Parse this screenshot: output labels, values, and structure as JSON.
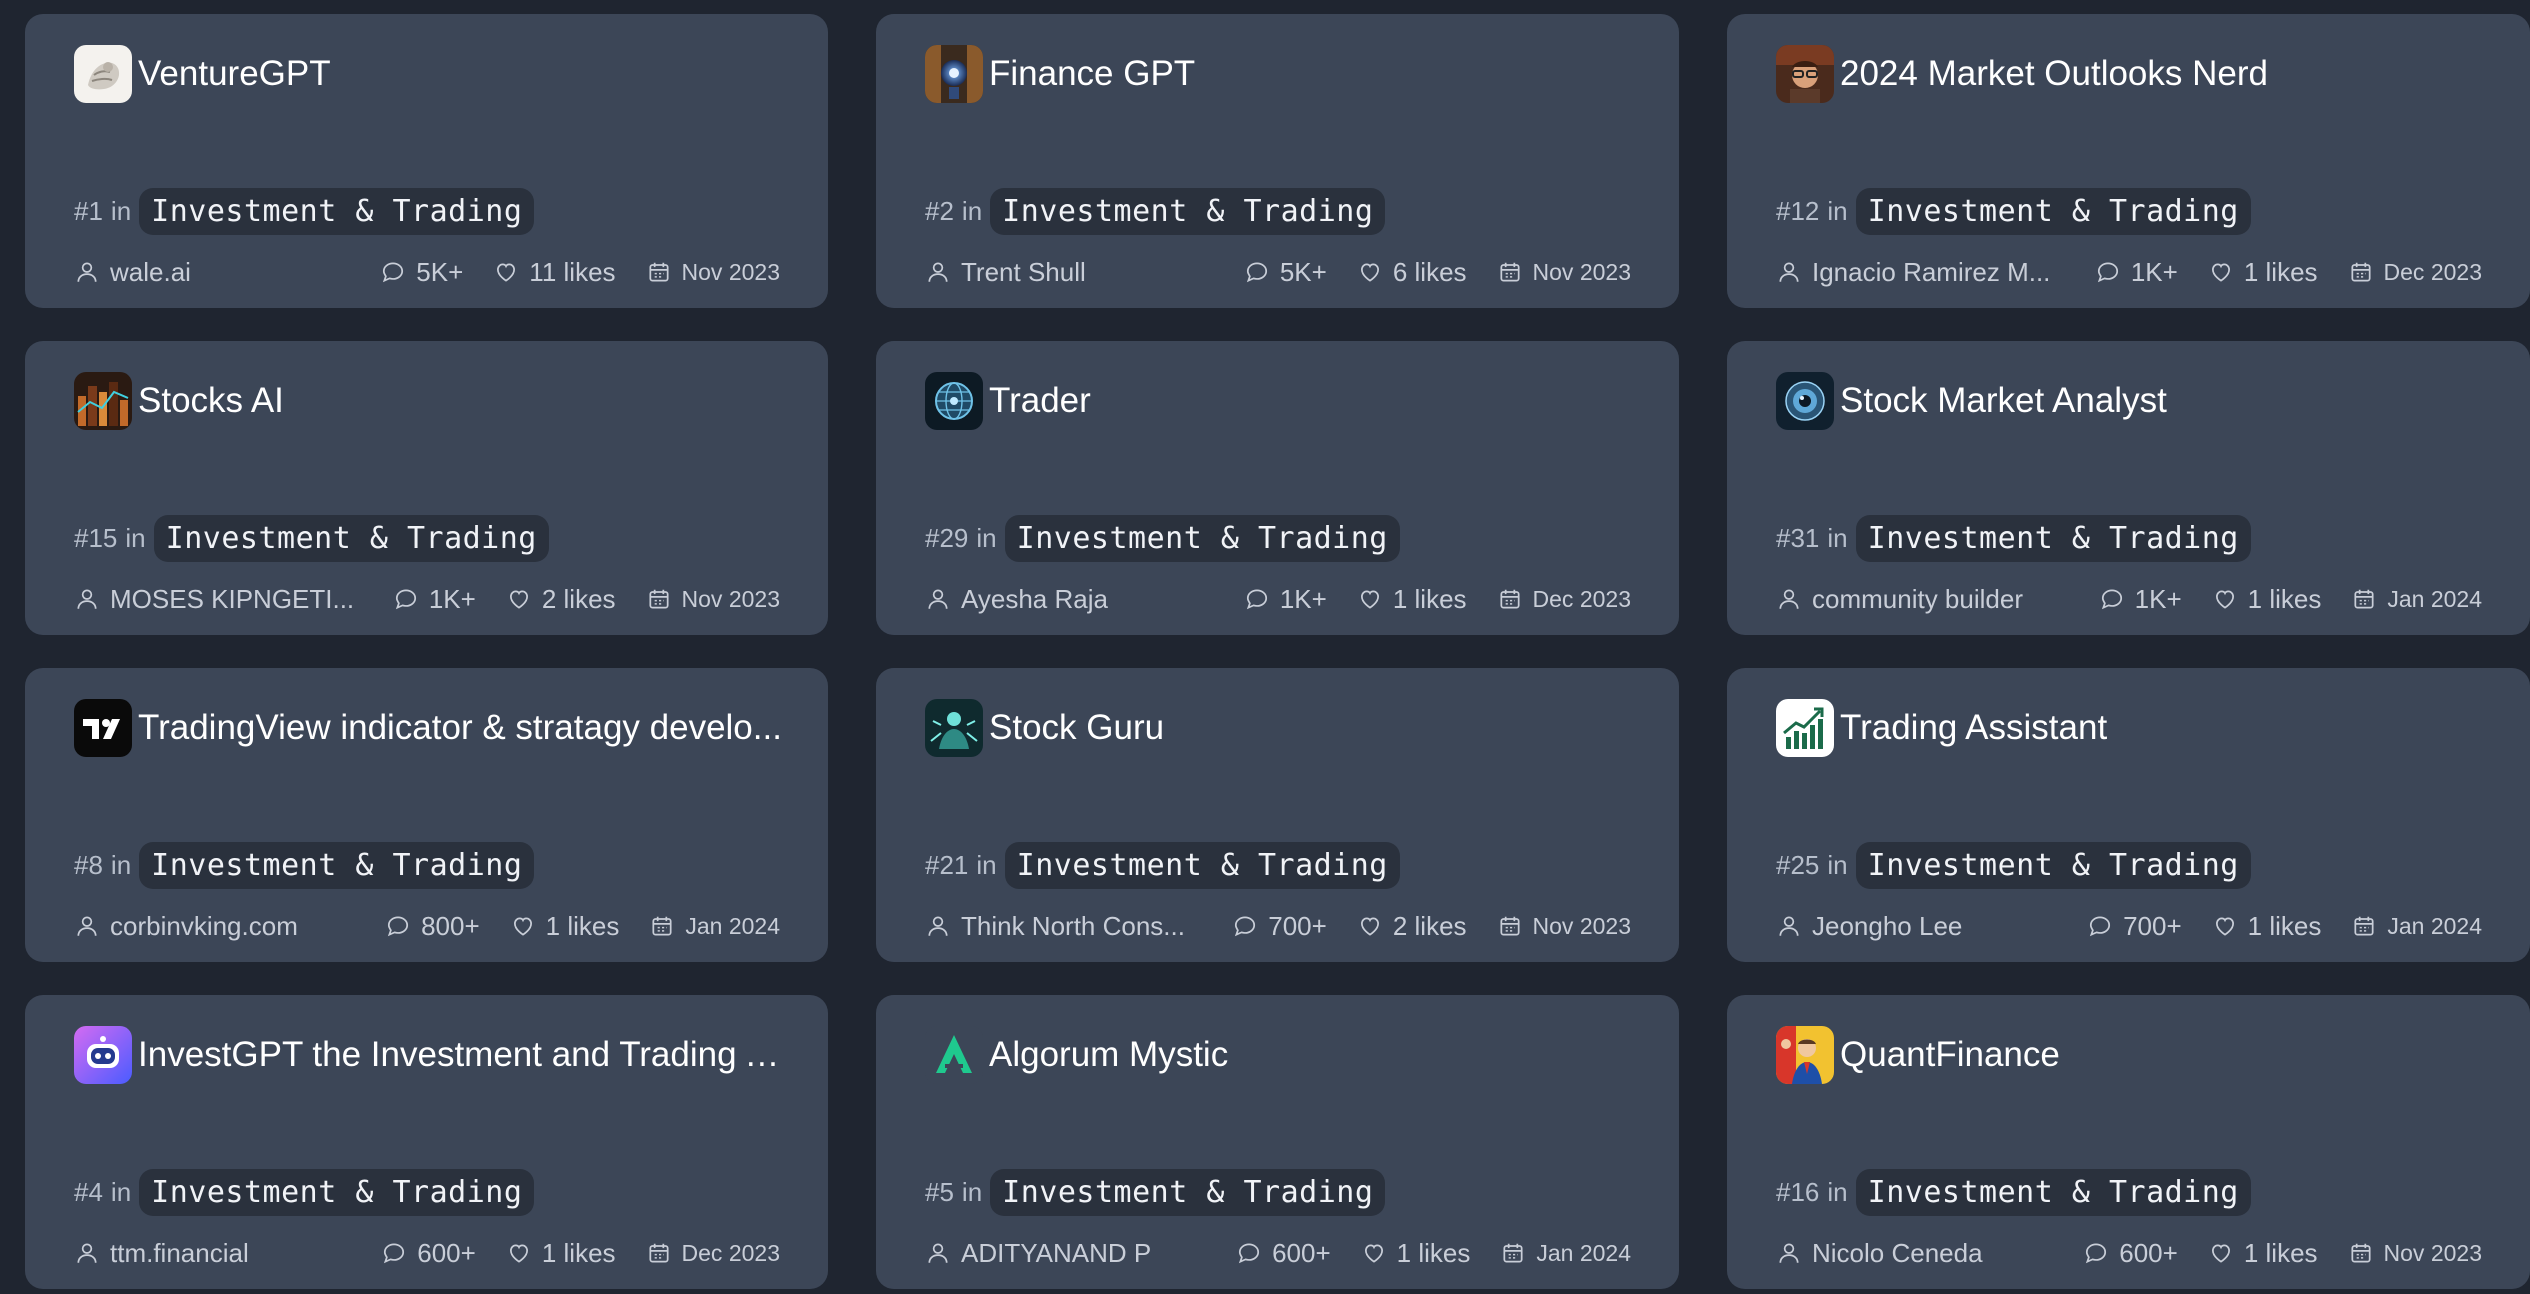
{
  "cards": [
    {
      "title": "VentureGPT",
      "rank": "#1",
      "in_label": "in",
      "category": "Investment & Trading",
      "author": "wale.ai",
      "conversations": "5K+",
      "likes": "11 likes",
      "date": "Nov 2023",
      "avatar_icon": "fist-sculpture-icon"
    },
    {
      "title": "Finance GPT",
      "rank": "#2",
      "in_label": "in",
      "category": "Investment & Trading",
      "author": "Trent Shull",
      "conversations": "5K+",
      "likes": "6 likes",
      "date": "Nov 2023",
      "avatar_icon": "robot-figure-icon"
    },
    {
      "title": "2024 Market Outlooks Nerd",
      "rank": "#12",
      "in_label": "in",
      "category": "Investment & Trading",
      "author": "Ignacio Ramirez M...",
      "conversations": "1K+",
      "likes": "1 likes",
      "date": "Dec 2023",
      "avatar_icon": "nerd-portrait-icon"
    },
    {
      "title": "Stocks AI",
      "rank": "#15",
      "in_label": "in",
      "category": "Investment & Trading",
      "author": "MOSES KIPNGETI...",
      "conversations": "1K+",
      "likes": "2 likes",
      "date": "Nov 2023",
      "avatar_icon": "city-chart-icon"
    },
    {
      "title": "Trader",
      "rank": "#29",
      "in_label": "in",
      "category": "Investment & Trading",
      "author": "Ayesha Raja",
      "conversations": "1K+",
      "likes": "1 likes",
      "date": "Dec 2023",
      "avatar_icon": "globe-orb-icon"
    },
    {
      "title": "Stock Market Analyst",
      "rank": "#31",
      "in_label": "in",
      "category": "Investment & Trading",
      "author": "community builder",
      "conversations": "1K+",
      "likes": "1 likes",
      "date": "Jan 2024",
      "avatar_icon": "eye-orb-icon"
    },
    {
      "title": "TradingView indicator & stratagy develo...",
      "rank": "#8",
      "in_label": "in",
      "category": "Investment & Trading",
      "author": "corbinvking.com",
      "conversations": "800+",
      "likes": "1 likes",
      "date": "Jan 2024",
      "avatar_icon": "tradingview-logo-icon"
    },
    {
      "title": "Stock Guru",
      "rank": "#21",
      "in_label": "in",
      "category": "Investment & Trading",
      "author": "Think North Cons...",
      "conversations": "700+",
      "likes": "2 likes",
      "date": "Nov 2023",
      "avatar_icon": "guru-figure-icon"
    },
    {
      "title": "Trading Assistant",
      "rank": "#25",
      "in_label": "in",
      "category": "Investment & Trading",
      "author": "Jeongho Lee",
      "conversations": "700+",
      "likes": "1 likes",
      "date": "Jan 2024",
      "avatar_icon": "rising-chart-icon"
    },
    {
      "title": "InvestGPT the Investment and Trading A...",
      "rank": "#4",
      "in_label": "in",
      "category": "Investment & Trading",
      "author": "ttm.financial",
      "conversations": "600+",
      "likes": "1 likes",
      "date": "Dec 2023",
      "avatar_icon": "robot-face-icon"
    },
    {
      "title": "Algorum Mystic",
      "rank": "#5",
      "in_label": "in",
      "category": "Investment & Trading",
      "author": "ADITYANAND P",
      "conversations": "600+",
      "likes": "1 likes",
      "date": "Jan 2024",
      "avatar_icon": "algorum-logo-icon"
    },
    {
      "title": "QuantFinance",
      "rank": "#16",
      "in_label": "in",
      "category": "Investment & Trading",
      "author": "Nicolo Ceneda",
      "conversations": "600+",
      "likes": "1 likes",
      "date": "Nov 2023",
      "avatar_icon": "comic-businessman-icon"
    }
  ],
  "colors": {
    "page_bg": "#1f2530",
    "card_bg": "#3c4657",
    "chip_bg": "#2a313d",
    "meta_text": "#c9ced8"
  }
}
